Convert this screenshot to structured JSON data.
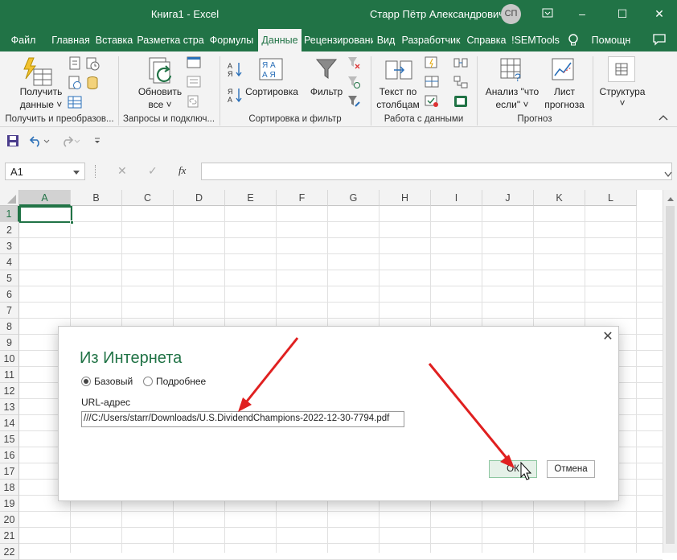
{
  "window": {
    "title": "Книга1  -  Excel",
    "user": "Старр Пётр Александрович",
    "avatar_initials": "СП",
    "minimize_icon": "–",
    "restore_icon": "⧉",
    "maximize_icon": "☐",
    "close_icon": "✕"
  },
  "tabs": [
    {
      "label": "Файл"
    },
    {
      "label": "Главная"
    },
    {
      "label": "Вставка"
    },
    {
      "label": "Разметка стра"
    },
    {
      "label": "Формулы"
    },
    {
      "label": "Данные"
    },
    {
      "label": "Рецензировани"
    },
    {
      "label": "Вид"
    },
    {
      "label": "Разработчик"
    },
    {
      "label": "Справка"
    },
    {
      "label": "!SEMTools"
    },
    {
      "label": "Помощн"
    }
  ],
  "ribbon": {
    "get_data": {
      "line1": "Получить",
      "line2": "данные ˅"
    },
    "refresh_all": {
      "line1": "Обновить",
      "line2": "все ˅"
    },
    "sort_az": "А↓Я",
    "sort": "Сортировка",
    "filter": "Фильтр",
    "text_to_columns": {
      "line1": "Текст по",
      "line2": "столбцам"
    },
    "what_if": {
      "line1": "Анализ \"что",
      "line2": "если\" ˅"
    },
    "forecast_sheet": {
      "line1": "Лист",
      "line2": "прогноза"
    },
    "outline": {
      "line1": "Структура",
      "line2": "˅"
    },
    "groups": {
      "get_transform": "Получить и преобразов...",
      "queries": "Запросы и подключ...",
      "sort_filter": "Сортировка и фильтр",
      "data_tools": "Работа с данными",
      "forecast": "Прогноз"
    }
  },
  "formula_bar": {
    "name_box": "A1",
    "cancel_glyph": "✕",
    "enter_glyph": "✓",
    "fx_glyph": "fx",
    "formula": ""
  },
  "grid": {
    "columns": [
      "A",
      "B",
      "C",
      "D",
      "E",
      "F",
      "G",
      "H",
      "I",
      "J",
      "K",
      "L"
    ],
    "rows": [
      "1",
      "2",
      "3",
      "4",
      "5",
      "6",
      "7",
      "8",
      "9",
      "10",
      "11",
      "12",
      "13",
      "14",
      "15",
      "16",
      "17",
      "18",
      "19",
      "20",
      "21",
      "22"
    ]
  },
  "dialog": {
    "title": "Из Интернета",
    "radio_basic": "Базовый",
    "radio_advanced": "Подробнее",
    "url_label": "URL-адрес",
    "url_value": "///C:/Users/starr/Downloads/U.S.DividendChampions-2022-12-30-7794.pdf",
    "ok": "ОК",
    "cancel": "Отмена",
    "close_glyph": "✕"
  },
  "colors": {
    "excel_green": "#217346",
    "annotation_arrow": "#e02020"
  }
}
